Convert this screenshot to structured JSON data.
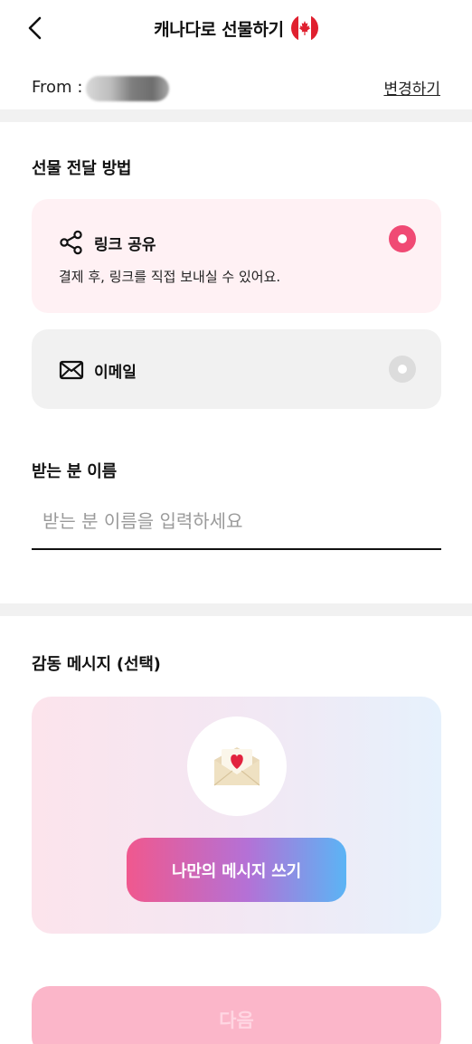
{
  "header": {
    "title": "캐나다로 선물하기",
    "flag": "canada-flag"
  },
  "sender": {
    "from_label": "From :",
    "change_label": "변경하기"
  },
  "delivery": {
    "section_title": "선물 전달 방법",
    "options": [
      {
        "icon": "share-icon",
        "label": "링크 공유",
        "description": "결제 후, 링크를 직접 보내실 수 있어요.",
        "selected": true
      },
      {
        "icon": "mail-icon",
        "label": "이메일",
        "selected": false
      }
    ]
  },
  "recipient": {
    "section_title": "받는 분 이름",
    "placeholder": "받는 분 이름을 입력하세요",
    "value": ""
  },
  "message": {
    "section_title": "감동 메시지 (선택)",
    "icon": "love-letter-icon",
    "button_label": "나만의 메시지 쓰기"
  },
  "footer": {
    "next_label": "다음"
  },
  "colors": {
    "accent": "#f04a74",
    "link_option_bg": "#fff1f4",
    "email_option_bg": "#f1f1f1",
    "next_button_bg": "#fbb6c9",
    "divider": "#f1f1f1"
  }
}
